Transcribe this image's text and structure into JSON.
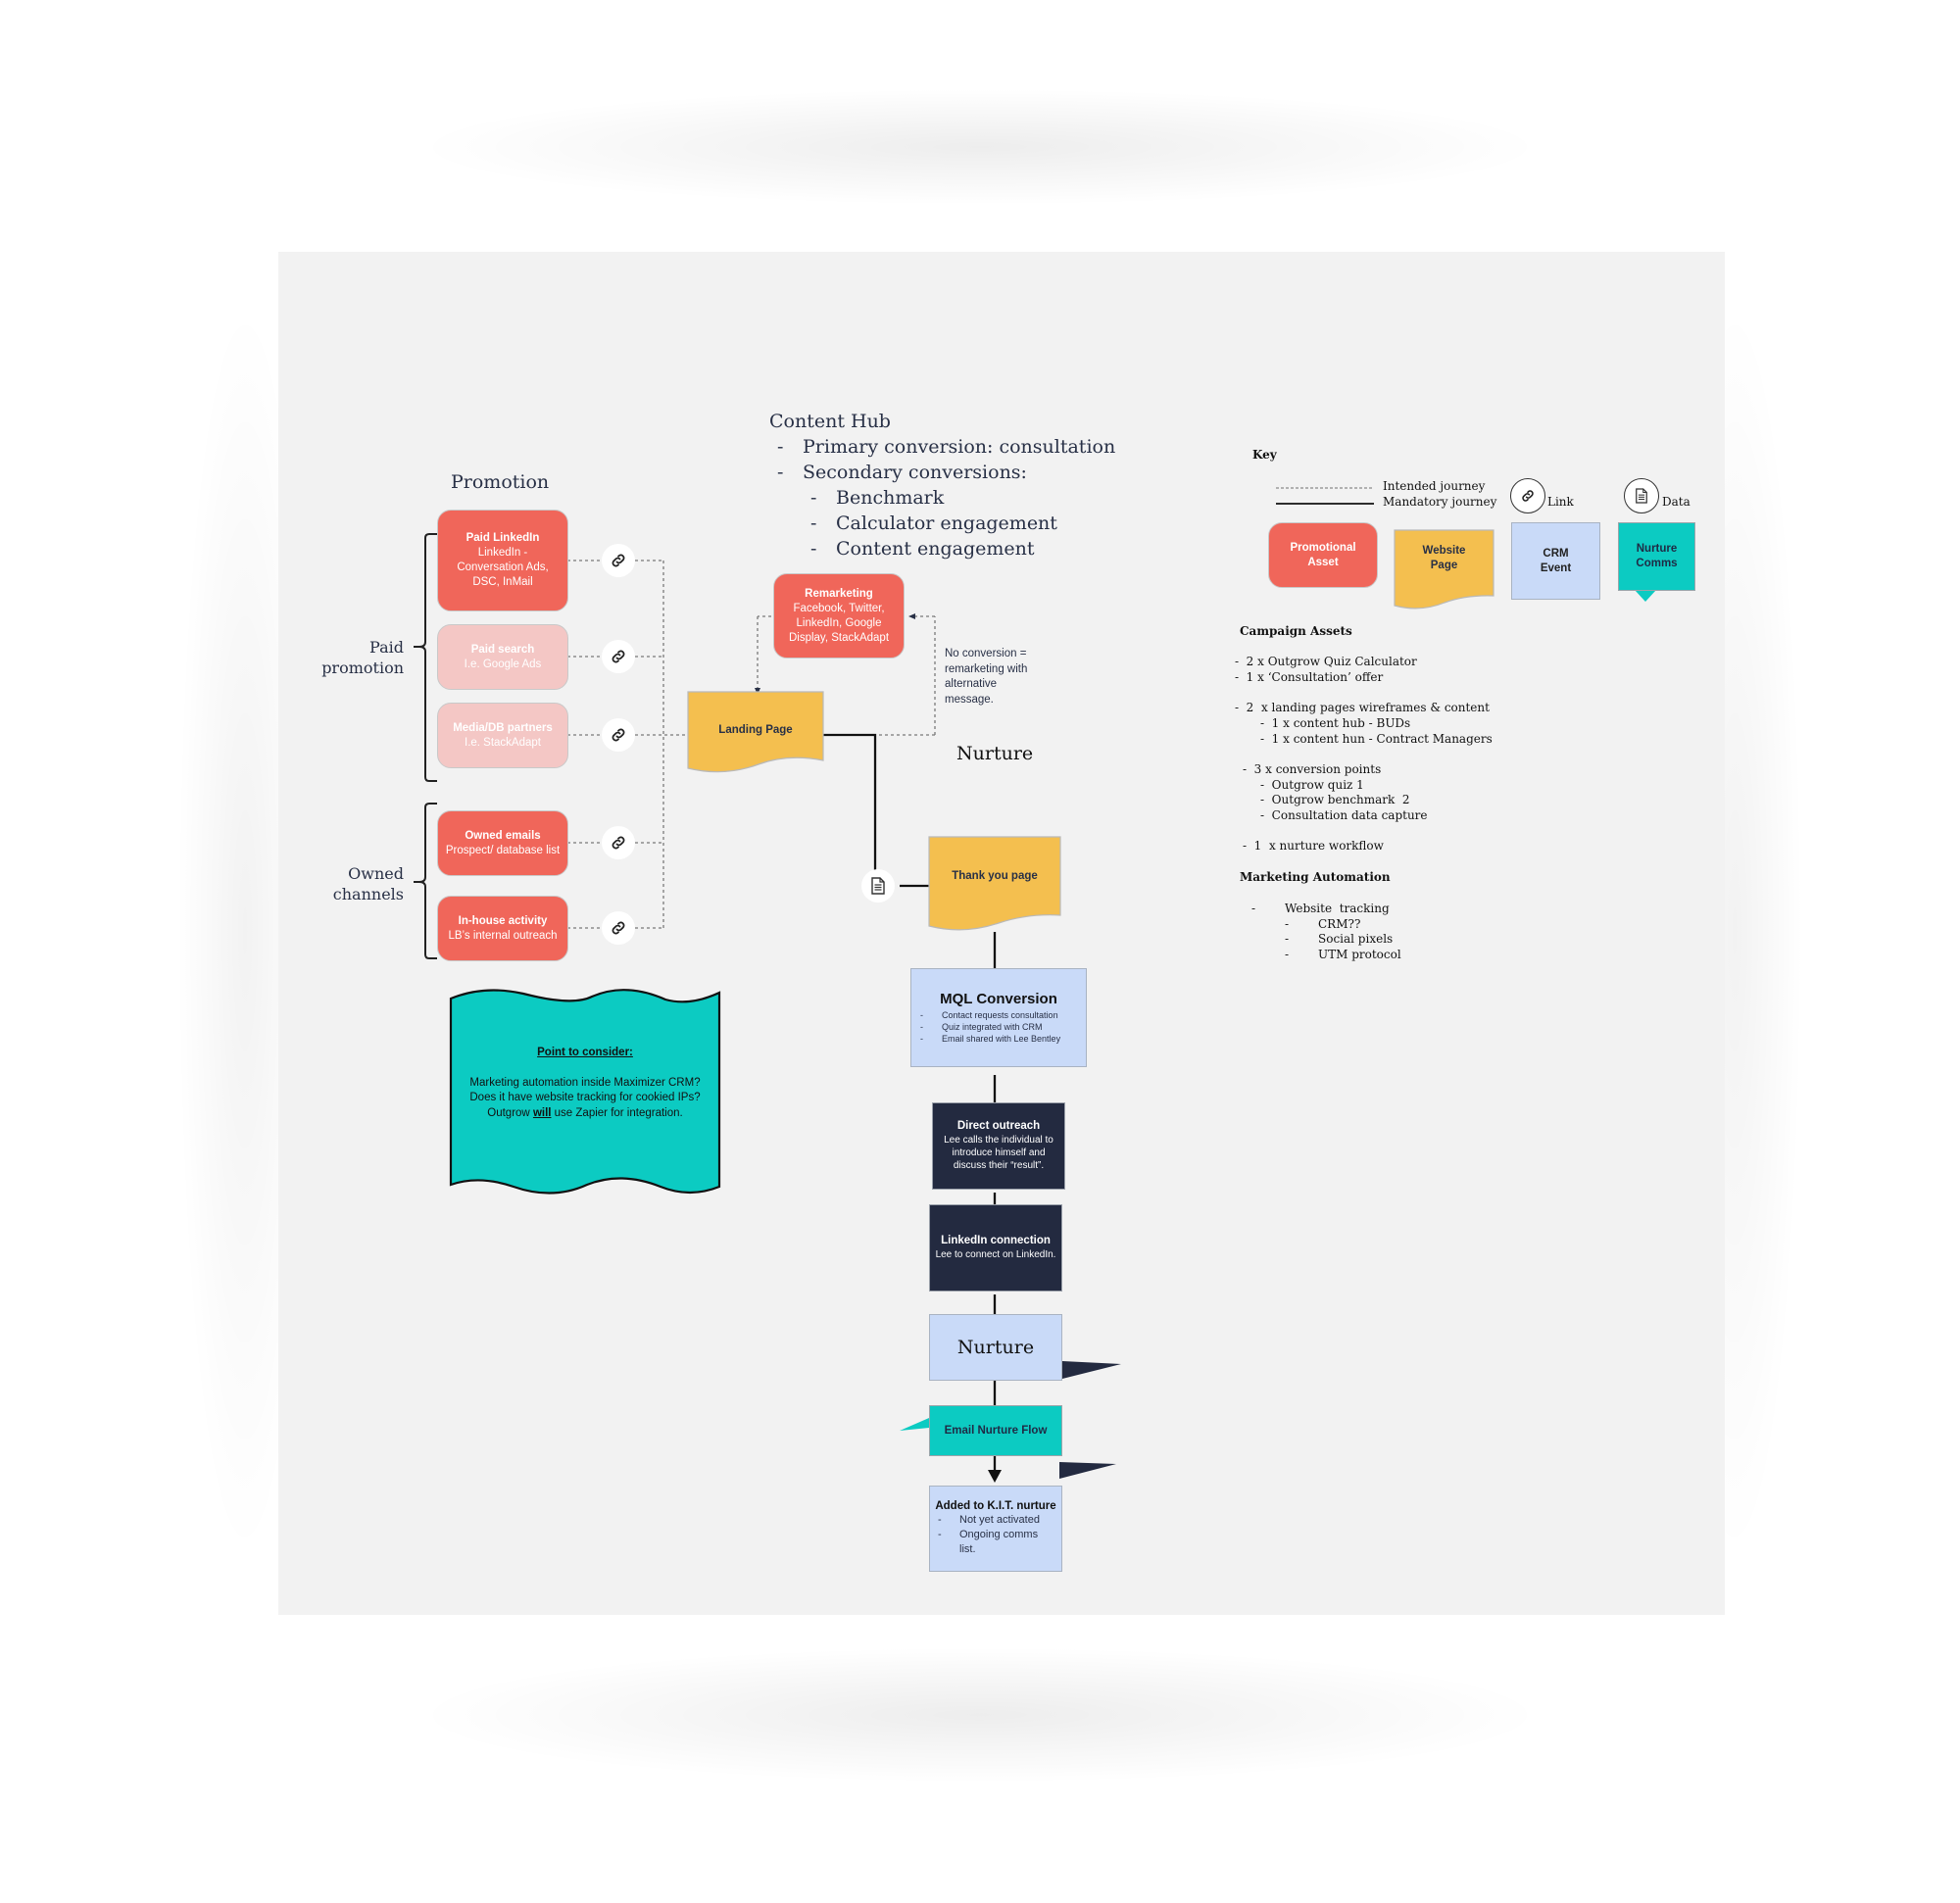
{
  "promotion": {
    "heading": "Promotion",
    "groups": [
      {
        "label_line1": "Paid",
        "label_line2": "promotion"
      },
      {
        "label_line1": "Owned",
        "label_line2": "channels"
      }
    ],
    "assets": [
      {
        "title": "Paid LinkedIn",
        "lines": [
          "LinkedIn -",
          "Conversation Ads,",
          "DSC, InMail"
        ],
        "faded": false
      },
      {
        "title": "Paid search",
        "lines": [
          "I.e. Google Ads"
        ],
        "faded": true
      },
      {
        "title": "Media/DB partners",
        "lines": [
          "I.e. StackAdapt"
        ],
        "faded": true
      },
      {
        "title": "Owned emails",
        "lines": [
          "Prospect/ database list"
        ],
        "faded": false
      },
      {
        "title": "In-house activity",
        "lines": [
          "LB’s internal outreach"
        ],
        "faded": false
      }
    ],
    "link_icon": "link-icon"
  },
  "note": {
    "title": "Point to consider:",
    "line1": "Marketing automation inside Maximizer CRM?",
    "line2": "Does it have website tracking for cookied IPs?",
    "line3_pre": "Outgrow ",
    "line3_em": "will",
    "line3_post": " use Zapier for integration."
  },
  "content_hub": {
    "title": "Content Hub",
    "items": [
      {
        "level": 1,
        "text": "Primary conversion: consultation"
      },
      {
        "level": 1,
        "text": "Secondary conversions:"
      },
      {
        "level": 2,
        "text": "Benchmark"
      },
      {
        "level": 2,
        "text": "Calculator engagement"
      },
      {
        "level": 2,
        "text": "Content engagement"
      }
    ]
  },
  "remarketing": {
    "title": "Remarketing",
    "lines": [
      "Facebook, Twitter,",
      "LinkedIn, Google",
      "Display, StackAdapt"
    ]
  },
  "no_conversion_note": [
    "No conversion =",
    "remarketing with",
    "alternative",
    "message."
  ],
  "landing_page": {
    "label": "Landing Page"
  },
  "nurture_heading": "Nurture",
  "thank_you_page": {
    "label": "Thank you page"
  },
  "data_icon": "document-icon",
  "mql": {
    "title": "MQL Conversion",
    "items": [
      "Contact requests consultation",
      "Quiz integrated with CRM",
      "Email shared with Lee Bentley"
    ]
  },
  "direct_outreach": {
    "title": "Direct outreach",
    "lines": [
      "Lee calls the individual to",
      "introduce himself and",
      "discuss their “result”."
    ]
  },
  "linkedin_connection": {
    "title": "LinkedIn connection",
    "lines": [
      "Lee to connect on LinkedIn."
    ]
  },
  "nurture_box": {
    "label": "Nurture"
  },
  "email_nurture": {
    "label": "Email Nurture Flow"
  },
  "kit": {
    "title": "Added to K.I.T.  nurture",
    "items": [
      "Not yet activated",
      "Ongoing comms list."
    ]
  },
  "key": {
    "title": "Key",
    "intended": "Intended journey",
    "mandatory": "Mandatory journey",
    "link": "Link",
    "data": "Data",
    "shapes": [
      {
        "line1": "Promotional",
        "line2": "Asset"
      },
      {
        "line1": "Website",
        "line2": "Page"
      },
      {
        "line1": "CRM",
        "line2": "Event"
      },
      {
        "line1": "Nurture",
        "line2": "Comms"
      }
    ]
  },
  "campaign_assets": {
    "title": "Campaign Assets",
    "lines": [
      {
        "indent": 0,
        "text": "-  2 x Outgrow Quiz Calculator"
      },
      {
        "indent": 0,
        "text": "-  1 x ‘Consultation’ offer"
      },
      {
        "indent": 0,
        "text": ""
      },
      {
        "indent": 0,
        "text": "-  2  x landing pages wireframes & content"
      },
      {
        "indent": 2,
        "text": "-  1 x content hub - BUDs"
      },
      {
        "indent": 2,
        "text": "-  1 x content hun - Contract Managers"
      },
      {
        "indent": 0,
        "text": ""
      },
      {
        "indent": 1,
        "text": "-  3 x conversion points"
      },
      {
        "indent": 2,
        "text": "-  Outgrow quiz 1"
      },
      {
        "indent": 2,
        "text": "-  Outgrow benchmark  2"
      },
      {
        "indent": 2,
        "text": "-  Consultation data capture"
      },
      {
        "indent": 0,
        "text": ""
      },
      {
        "indent": 1,
        "text": "-  1  x nurture workflow"
      }
    ]
  },
  "marketing_automation": {
    "title": "Marketing Automation",
    "items": [
      {
        "level": 1,
        "text": "Website  tracking"
      },
      {
        "level": 2,
        "text": "CRM??"
      },
      {
        "level": 2,
        "text": "Social pixels"
      },
      {
        "level": 2,
        "text": "UTM protocol"
      }
    ]
  },
  "colors": {
    "promotional_asset": "#f0665a",
    "promotional_asset_faded": "#f4c7c5",
    "website_page": "#f4bf4f",
    "crm_event": "#c9daf8",
    "nurture_comms": "#0ccbc2",
    "dark_event": "#232a40",
    "canvas": "#f2f2f2",
    "text": "#283046"
  }
}
